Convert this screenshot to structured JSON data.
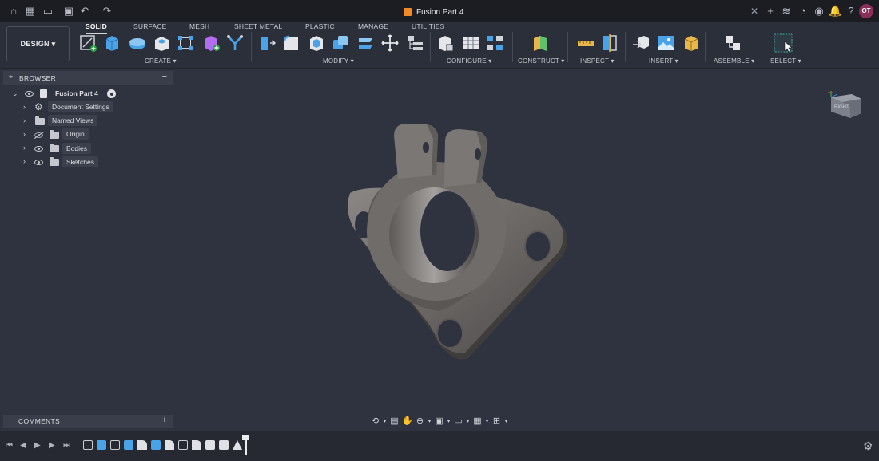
{
  "titlebar": {
    "document_title": "Fusion Part 4",
    "user_initials": "OT"
  },
  "toolbar": {
    "workspace_button": "DESIGN",
    "tabs": [
      "SOLID",
      "SURFACE",
      "MESH",
      "SHEET METAL",
      "PLASTIC",
      "MANAGE",
      "UTILITIES"
    ],
    "active_tab": "SOLID",
    "groups": {
      "create": "CREATE",
      "modify": "MODIFY",
      "configure": "CONFIGURE",
      "construct": "CONSTRUCT",
      "inspect": "INSPECT",
      "insert": "INSERT",
      "assemble": "ASSEMBLE",
      "select": "SELECT"
    }
  },
  "browser": {
    "title": "BROWSER",
    "root": "Fusion Part 4",
    "items": [
      "Document Settings",
      "Named Views",
      "Origin",
      "Bodies",
      "Sketches"
    ]
  },
  "comments": {
    "title": "COMMENTS"
  },
  "viewcube": {
    "label": "RIGHT"
  },
  "colors": {
    "background": "#2f3340",
    "toolbar": "#2b2f39",
    "titlebar": "#1b1d22",
    "accent_orange": "#f08a24",
    "accent_blue": "#4aa3e8",
    "avatar": "#8c2d5a"
  }
}
